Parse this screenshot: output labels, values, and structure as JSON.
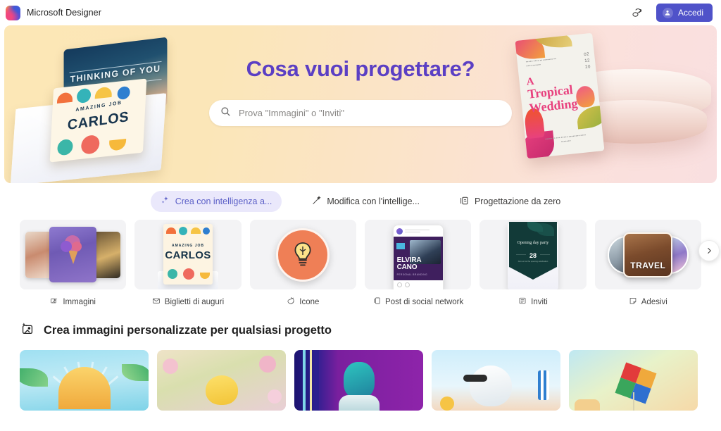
{
  "app": {
    "name": "Microsoft Designer",
    "logo_icon": "designer-logo-icon"
  },
  "header": {
    "feedback_icon": "feedback-chat-icon",
    "signin_label": "Accedi",
    "signin_avatar_icon": "person-circle-icon"
  },
  "hero": {
    "title": "Cosa vuoi progettare?",
    "search_placeholder": "Prova \"Immagini\" o \"Inviti\"",
    "search_value": "",
    "search_icon": "search-icon",
    "art_left": {
      "card_top_text": "THINKING OF YOU",
      "card_bottom_kicker": "AMAZING JOB",
      "card_bottom_name": "CARLOS"
    },
    "art_right": {
      "title_line1": "A",
      "title_line2": "Tropical",
      "title_line3": "Wedding",
      "dates": [
        "02",
        "12",
        "20"
      ]
    }
  },
  "tabs": [
    {
      "label": "Crea con intelligenza a...",
      "icon": "sparkle-icon",
      "active": true
    },
    {
      "label": "Modifica con l'intellige...",
      "icon": "magic-wand-icon",
      "active": false
    },
    {
      "label": "Progettazione da zero",
      "icon": "design-blank-icon",
      "active": false
    }
  ],
  "categories": [
    {
      "label": "Immagini",
      "icon": "images-icon"
    },
    {
      "label": "Biglietti di auguri",
      "icon": "envelope-icon"
    },
    {
      "label": "Icone",
      "icon": "sticker-icon"
    },
    {
      "label": "Post di social network",
      "icon": "social-post-icon"
    },
    {
      "label": "Inviti",
      "icon": "invite-icon"
    },
    {
      "label": "Adesivi",
      "icon": "adesivi-icon"
    }
  ],
  "carousel": {
    "next_icon": "chevron-right-icon"
  },
  "cards_art": {
    "greeting_kicker": "AMAZING JOB",
    "greeting_name": "CARLOS",
    "social_name_line1": "ELVIRA",
    "social_name_line2": "CANO",
    "social_sub": "PERSONAL BRANDING",
    "invite_title": "Opening day party",
    "invite_number": "28",
    "invite_footer": "Join us for the opening celebration",
    "sticker_word": "TRAVEL"
  },
  "section": {
    "icon": "sparkle-image-icon",
    "title": "Crea immagini personalizzate per qualsiasi progetto"
  },
  "gallery": [
    {
      "alt": "tropical-sunrise"
    },
    {
      "alt": "yellow-bird-blossoms"
    },
    {
      "alt": "teal-portrait"
    },
    {
      "alt": "yeti-beach-chair"
    },
    {
      "alt": "rainbow-kite"
    }
  ],
  "colors": {
    "accent": "#4f52c9",
    "hero_title": "#5b3fc4",
    "tab_active_bg": "#eae8fb",
    "tab_active_text": "#5b5fc7"
  }
}
